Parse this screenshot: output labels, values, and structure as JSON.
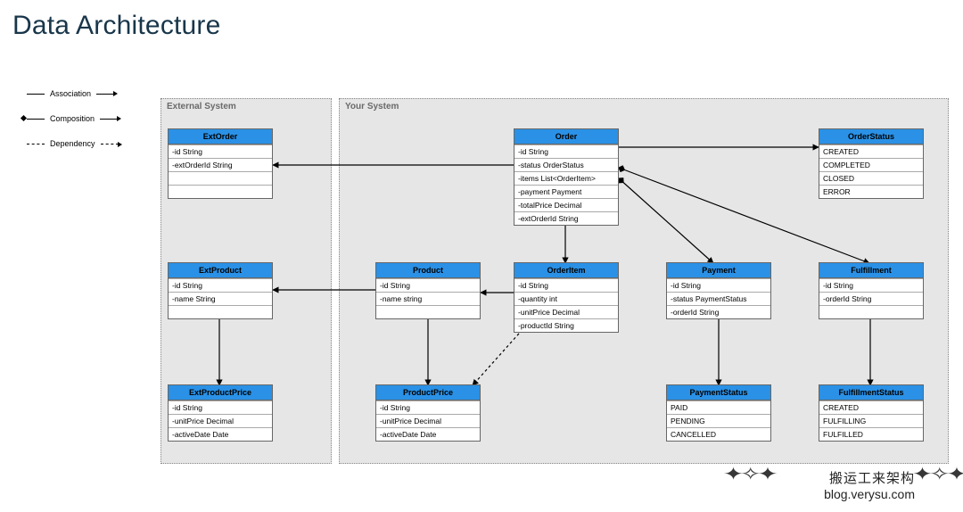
{
  "page_title": "Data Architecture",
  "legend": {
    "association": "Association",
    "composition": "Composition",
    "dependency": "Dependency"
  },
  "systems": {
    "external": {
      "label": "External System"
    },
    "your": {
      "label": "Your System"
    }
  },
  "entities": {
    "ext_order": {
      "name": "ExtOrder",
      "fields": [
        "-id String",
        "-extOrderId String"
      ],
      "blanks": 2
    },
    "order": {
      "name": "Order",
      "fields": [
        "-id String",
        "-status OrderStatus",
        "-items List<OrderItem>",
        "-payment Payment",
        "-totalPrice Decimal",
        "-extOrderId String"
      ],
      "blanks": 0
    },
    "order_status": {
      "name": "OrderStatus",
      "fields": [
        "CREATED",
        "COMPLETED",
        "CLOSED",
        "ERROR"
      ],
      "blanks": 0
    },
    "ext_product": {
      "name": "ExtProduct",
      "fields": [
        "-id String",
        "-name String"
      ],
      "blanks": 1
    },
    "product": {
      "name": "Product",
      "fields": [
        "-id String",
        "-name string"
      ],
      "blanks": 1
    },
    "order_item": {
      "name": "OrderItem",
      "fields": [
        "-id String",
        "-quantity int",
        "-unitPrice Decimal",
        "-productId String"
      ],
      "blanks": 0
    },
    "payment": {
      "name": "Payment",
      "fields": [
        "-id String",
        "-status PaymentStatus",
        "-orderId String"
      ],
      "blanks": 0
    },
    "fulfillment": {
      "name": "Fulfillment",
      "fields": [
        "-id String",
        "-orderId String"
      ],
      "blanks": 1
    },
    "ext_product_price": {
      "name": "ExtProductPrice",
      "fields": [
        "-id String",
        "-unitPrice Decimal",
        "-activeDate Date"
      ],
      "blanks": 0
    },
    "product_price": {
      "name": "ProductPrice",
      "fields": [
        "-id String",
        "-unitPrice Decimal",
        "-activeDate Date"
      ],
      "blanks": 0
    },
    "payment_status": {
      "name": "PaymentStatus",
      "fields": [
        "PAID",
        "PENDING",
        "CANCELLED"
      ],
      "blanks": 0
    },
    "fulfillment_status": {
      "name": "FulfillmentStatus",
      "fields": [
        "CREATED",
        "FULFILLING",
        "FULFILLED"
      ],
      "blanks": 0
    }
  },
  "watermark": {
    "cn": "搬运工来架构",
    "url": "blog.verysu.com"
  }
}
